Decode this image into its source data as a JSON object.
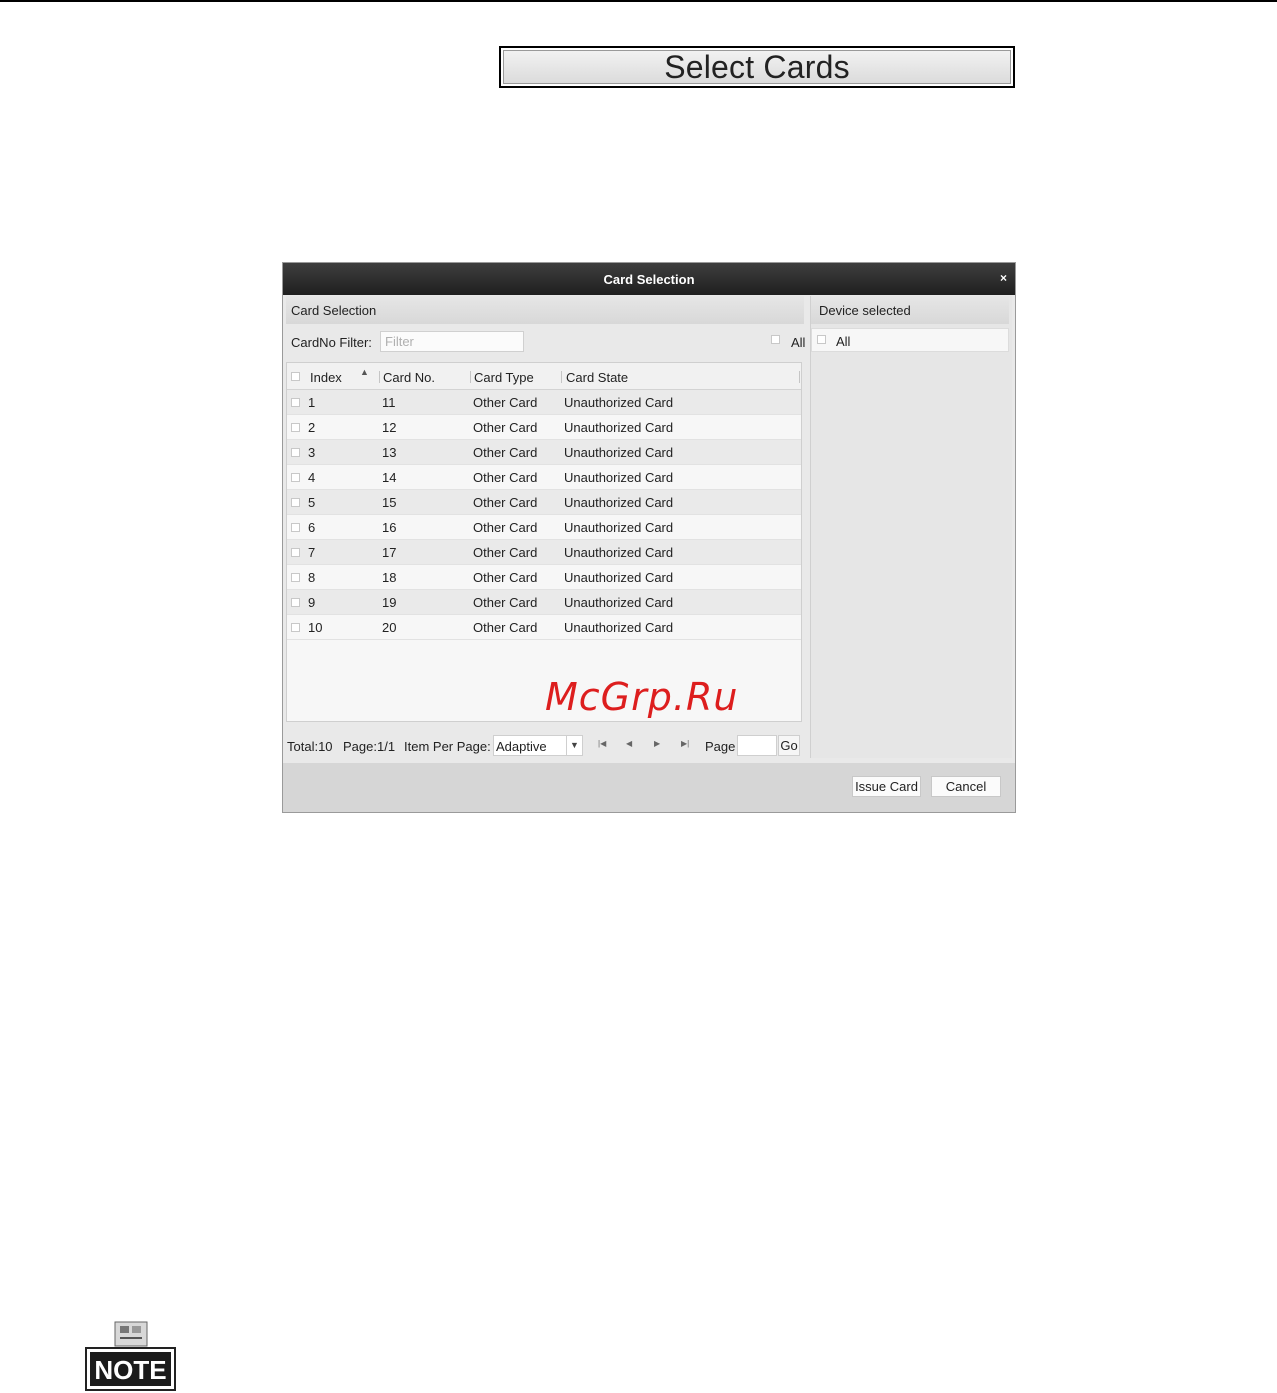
{
  "select_cards_label": "Select Cards",
  "dialog": {
    "title": "Card Selection",
    "close_glyph": "×",
    "card_panel": {
      "header": "Card Selection",
      "filter_label": "CardNo Filter:",
      "filter_placeholder": "Filter",
      "all_label": "All",
      "columns": [
        "Index",
        "Card No.",
        "Card Type",
        "Card State"
      ],
      "rows": [
        {
          "index": "1",
          "card_no": "11",
          "type": "Other Card",
          "state": "Unauthorized Card"
        },
        {
          "index": "2",
          "card_no": "12",
          "type": "Other Card",
          "state": "Unauthorized Card"
        },
        {
          "index": "3",
          "card_no": "13",
          "type": "Other Card",
          "state": "Unauthorized Card"
        },
        {
          "index": "4",
          "card_no": "14",
          "type": "Other Card",
          "state": "Unauthorized Card"
        },
        {
          "index": "5",
          "card_no": "15",
          "type": "Other Card",
          "state": "Unauthorized Card"
        },
        {
          "index": "6",
          "card_no": "16",
          "type": "Other Card",
          "state": "Unauthorized Card"
        },
        {
          "index": "7",
          "card_no": "17",
          "type": "Other Card",
          "state": "Unauthorized Card"
        },
        {
          "index": "8",
          "card_no": "18",
          "type": "Other Card",
          "state": "Unauthorized Card"
        },
        {
          "index": "9",
          "card_no": "19",
          "type": "Other Card",
          "state": "Unauthorized Card"
        },
        {
          "index": "10",
          "card_no": "20",
          "type": "Other Card",
          "state": "Unauthorized Card"
        }
      ]
    },
    "pager": {
      "total": "Total:10",
      "page": "Page:1/1",
      "per_page_label": "Item Per Page:",
      "per_page_value": "Adaptive",
      "page_label": "Page",
      "go_label": "Go"
    },
    "device_panel": {
      "header": "Device selected",
      "all_label": "All"
    },
    "issue_label": "Issue Card",
    "cancel_label": "Cancel"
  },
  "watermark": "McGrp.Ru",
  "note_label": "NOTE"
}
